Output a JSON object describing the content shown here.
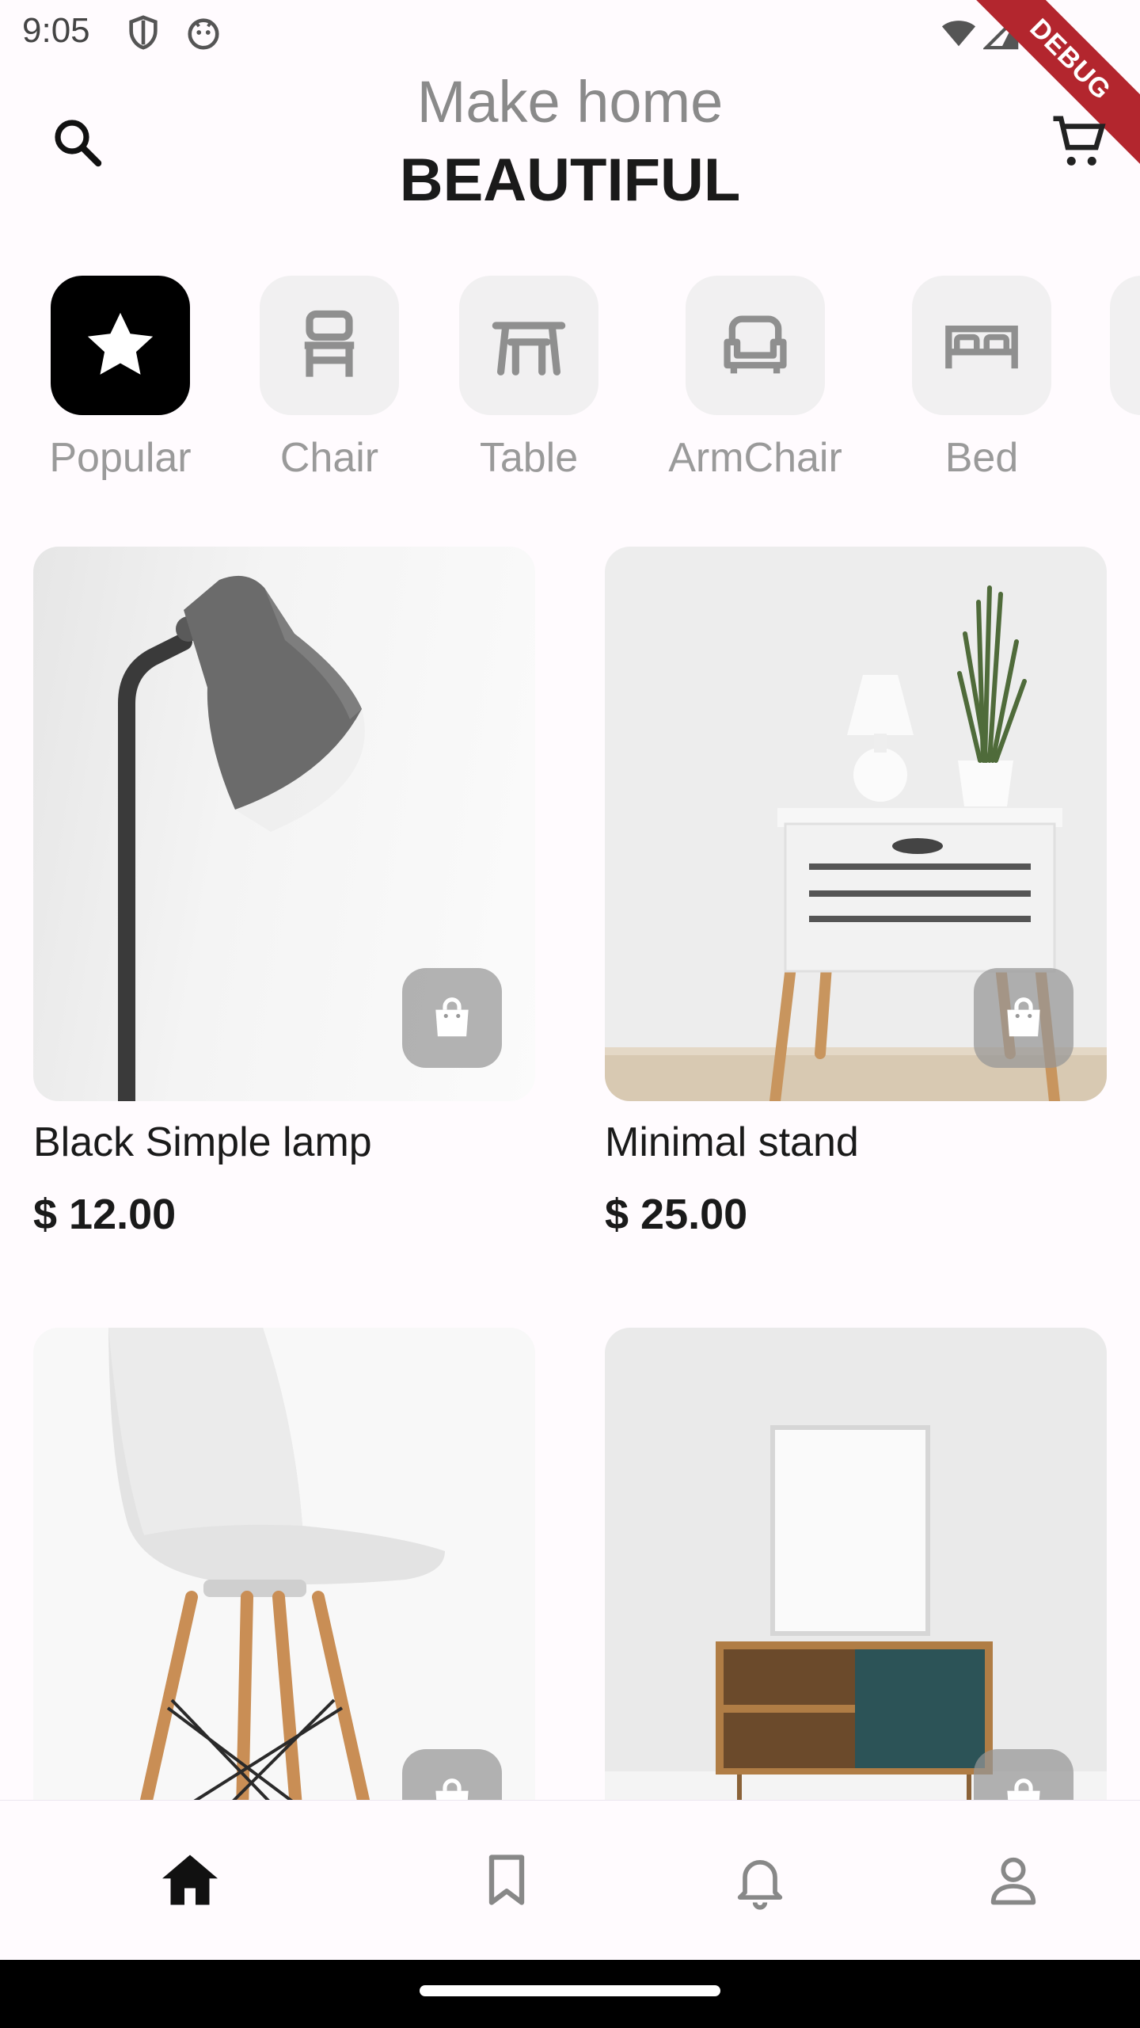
{
  "status_bar": {
    "time": "9:05",
    "debug_label": "DEBUG"
  },
  "header": {
    "title_line1": "Make home",
    "title_line2": "BEAUTIFUL"
  },
  "categories": [
    {
      "label": "Popular",
      "icon": "star-icon",
      "active": true
    },
    {
      "label": "Chair",
      "icon": "chair-icon"
    },
    {
      "label": "Table",
      "icon": "table-icon"
    },
    {
      "label": "ArmChair",
      "icon": "armchair-icon"
    },
    {
      "label": "Bed",
      "icon": "bed-icon"
    }
  ],
  "products": [
    {
      "name": "Black Simple lamp",
      "price": "$ 12.00",
      "image": "lamp"
    },
    {
      "name": "Minimal stand",
      "price": "$ 25.00",
      "image": "stand"
    },
    {
      "image": "chair"
    },
    {
      "image": "cabinet"
    }
  ],
  "bottom_nav": [
    {
      "icon": "home-icon",
      "active": true
    },
    {
      "icon": "bookmark-icon"
    },
    {
      "icon": "bell-icon"
    },
    {
      "icon": "profile-icon"
    }
  ],
  "colors": {
    "background": "#fffbfe",
    "active_category": "#000000",
    "category_bg": "#f1f0f1",
    "debug_banner": "#b3262e"
  }
}
